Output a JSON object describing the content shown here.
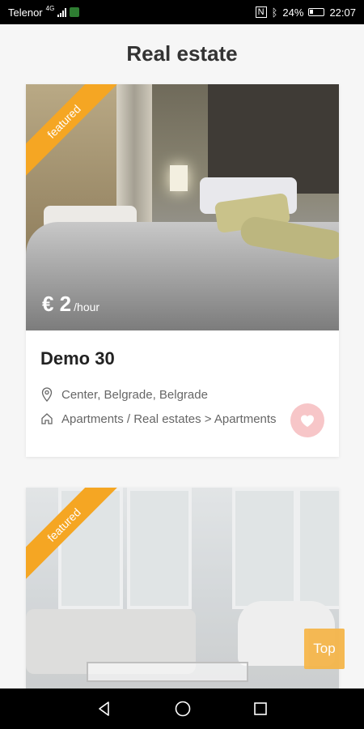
{
  "status_bar": {
    "carrier": "Telenor",
    "network_type": "4G",
    "battery_percent": "24%",
    "time": "22:07",
    "icons": [
      "signal-icon",
      "app-notification-icon",
      "nfc-icon",
      "bluetooth-icon",
      "battery-icon"
    ]
  },
  "header": {
    "title": "Real estate"
  },
  "listings": [
    {
      "badge": "featured",
      "price_amount": "€ 2",
      "price_unit": "/hour",
      "title": "Demo 30",
      "location": "Center, Belgrade, Belgrade",
      "category": "Apartments / Real estates > Apartments",
      "favorite_icon": "heart-icon"
    },
    {
      "badge": "featured"
    }
  ],
  "scroll_top": {
    "label": "Top"
  },
  "nav_bar": {
    "icons": [
      "back-icon",
      "home-icon",
      "recents-icon"
    ]
  },
  "colors": {
    "accent": "#f5a623",
    "favorite_bg": "#f7c6c8",
    "top_button": "#f5b64b"
  }
}
